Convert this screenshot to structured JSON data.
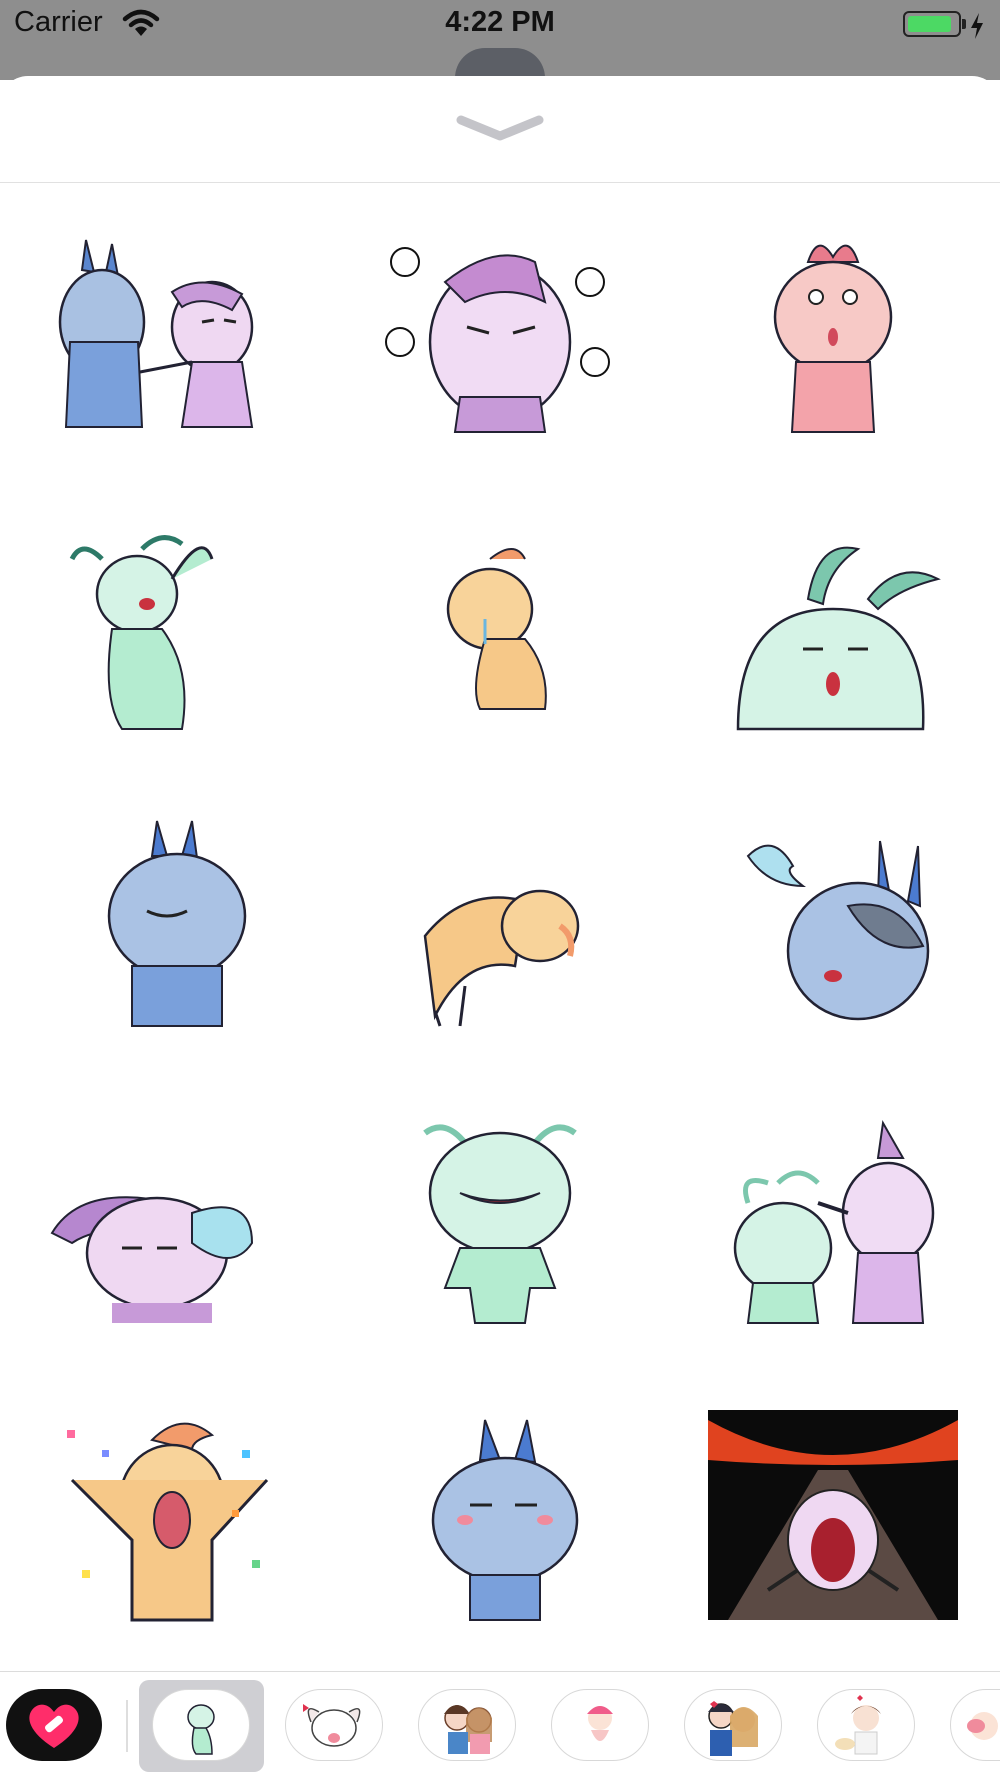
{
  "status_bar": {
    "carrier": "Carrier",
    "time": "4:22 PM",
    "battery_level": 0.9,
    "battery_color": "#4cd964",
    "charging": true
  },
  "sticker_sheet": {
    "collapse_icon": "chevron-down-icon",
    "stickers": [
      {
        "name": "blue-and-purple-bunnies-poking"
      },
      {
        "name": "purple-bunny-grumpy-scribbles"
      },
      {
        "name": "pink-bunny-shocked"
      },
      {
        "name": "green-bunny-laughing"
      },
      {
        "name": "orange-bunny-crying-kneeling"
      },
      {
        "name": "green-bunny-peeking"
      },
      {
        "name": "blue-bunny-smug-arms-crossed"
      },
      {
        "name": "orange-bunny-bowing"
      },
      {
        "name": "blue-bunny-with-ghost"
      },
      {
        "name": "purple-bunny-sleeping-with-bubble"
      },
      {
        "name": "green-bunny-grinning-hands-on-hips"
      },
      {
        "name": "green-and-purple-bunnies-patting"
      },
      {
        "name": "orange-bunny-celebrating-confetti"
      },
      {
        "name": "blue-bunny-blushing"
      },
      {
        "name": "purple-bunny-screaming-volcano"
      }
    ]
  },
  "app_tray": {
    "apps": [
      {
        "name": "heart-sticker-app",
        "icon": "heart-icon"
      },
      {
        "name": "bunny-stickers",
        "selected": true
      },
      {
        "name": "white-bunny-stickers"
      },
      {
        "name": "couple-stickers"
      },
      {
        "name": "pink-hat-baby-stickers"
      },
      {
        "name": "kissing-couple-stickers"
      },
      {
        "name": "chef-girl-stickers"
      },
      {
        "name": "partial-stickers"
      }
    ]
  }
}
